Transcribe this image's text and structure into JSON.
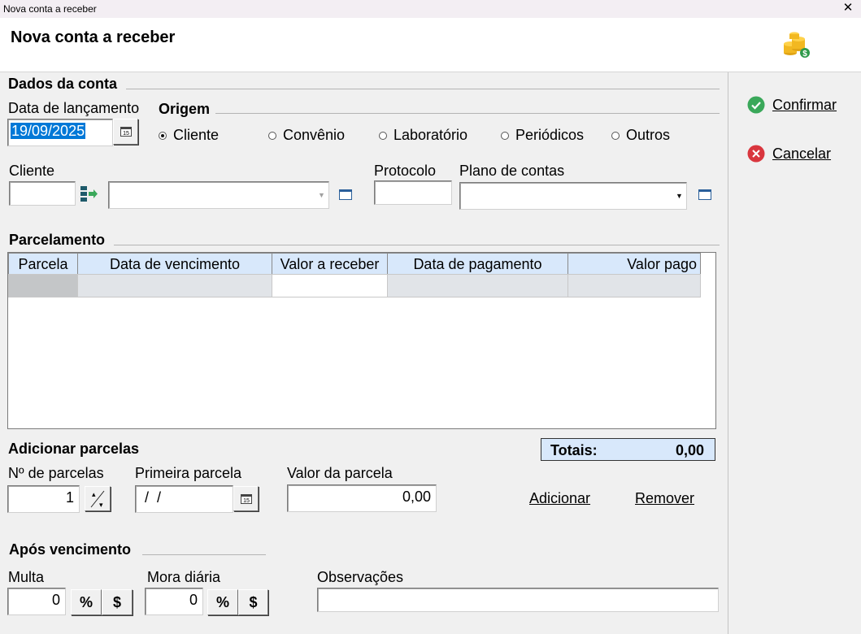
{
  "window": {
    "title": "Nova conta a receber",
    "close": "✕"
  },
  "header": {
    "title": "Nova conta a receber",
    "icon": "coins-dollar-icon"
  },
  "dados_conta": {
    "section": "Dados da conta",
    "data_lancamento_label": "Data de lançamento",
    "data_lancamento_value": "19/09/2025",
    "origem_label": "Origem",
    "origem_options": [
      "Cliente",
      "Convênio",
      "Laboratório",
      "Periódicos",
      "Outros"
    ],
    "origem_selected": "Cliente",
    "cliente_label": "Cliente",
    "cliente_code": "",
    "cliente_name": "",
    "protocolo_label": "Protocolo",
    "protocolo_value": "",
    "plano_label": "Plano de contas",
    "plano_value": ""
  },
  "parcelamento": {
    "section": "Parcelamento",
    "columns": [
      "Parcela",
      "Data de vencimento",
      "Valor a receber",
      "Data de pagamento",
      "Valor pago"
    ],
    "rows": [
      [
        "",
        "",
        "",
        "",
        ""
      ]
    ]
  },
  "totais": {
    "label": "Totais:",
    "value": "0,00"
  },
  "adicionar": {
    "section": "Adicionar parcelas",
    "num_label": "Nº de parcelas",
    "num_value": "1",
    "primeira_label": "Primeira parcela",
    "primeira_value": " /  /",
    "valor_label": "Valor da parcela",
    "valor_value": "0,00",
    "add_button": "Adicionar",
    "remove_button": "Remover"
  },
  "vencimento": {
    "section": "Após vencimento",
    "multa_label": "Multa",
    "multa_value": "0",
    "mora_label": "Mora diária",
    "mora_value": "0",
    "percent": "%",
    "dollar": "$",
    "obs_label": "Observações",
    "obs_value": ""
  },
  "actions": {
    "confirm": "Confirmar",
    "cancel": "Cancelar"
  },
  "colors": {
    "confirm": "#3aa85a",
    "cancel": "#d9363e",
    "grid_header": "#d8e8fb",
    "selection": "#0078d7"
  }
}
